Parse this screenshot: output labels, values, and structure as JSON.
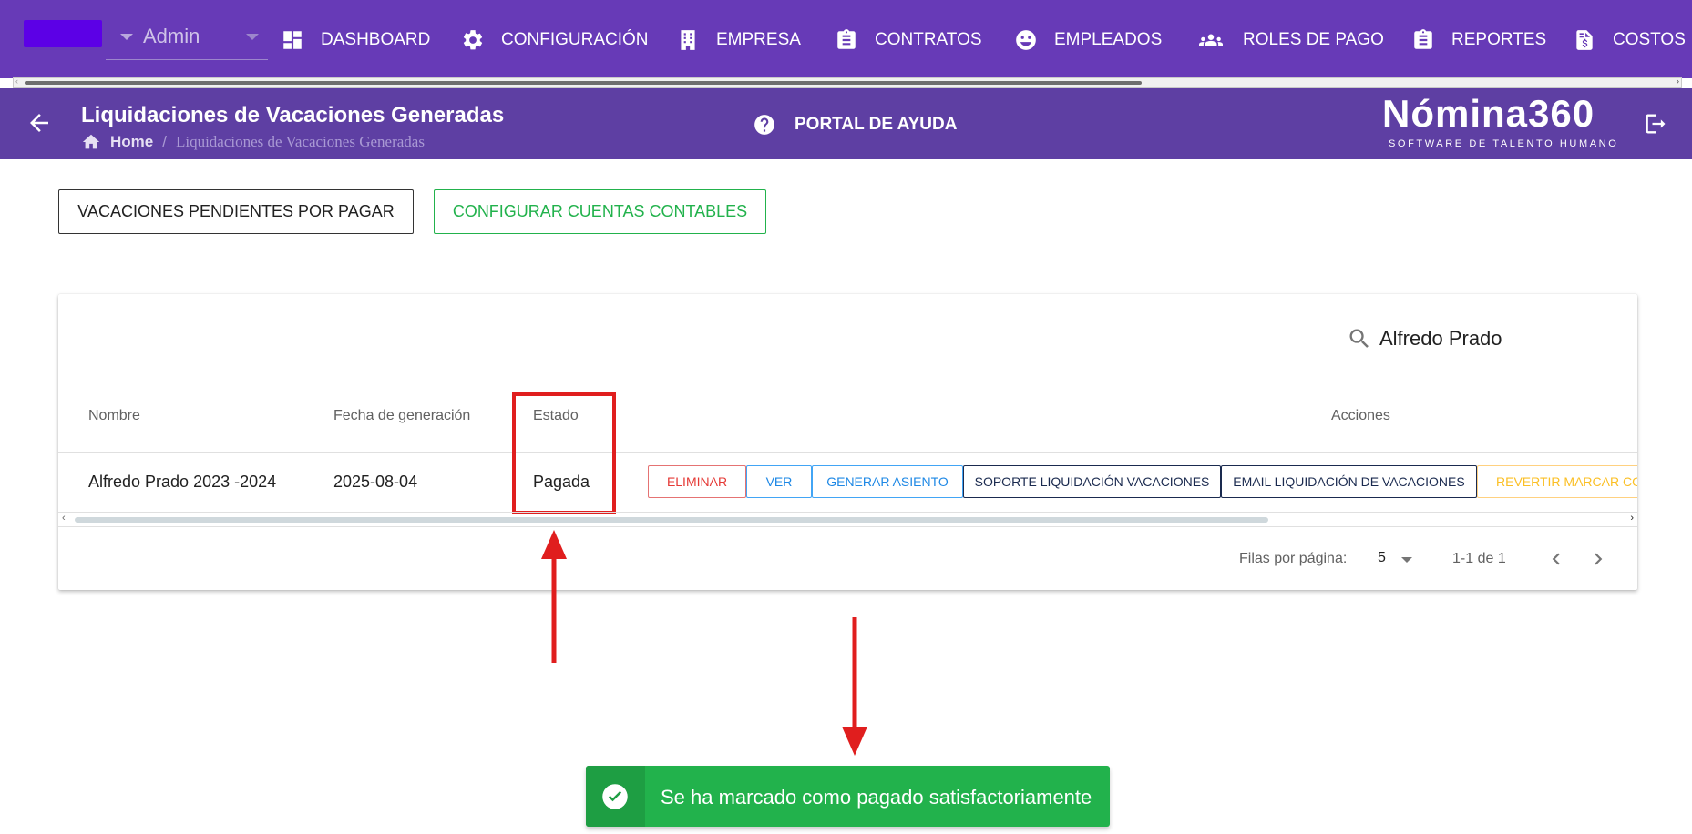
{
  "nav": {
    "role": "Admin",
    "items": [
      {
        "label": "DASHBOARD",
        "icon": "dashboard-icon"
      },
      {
        "label": "CONFIGURACIÓN",
        "icon": "gear-icon"
      },
      {
        "label": "EMPRESA",
        "icon": "building-icon"
      },
      {
        "label": "CONTRATOS",
        "icon": "clipboard-icon"
      },
      {
        "label": "EMPLEADOS",
        "icon": "face-icon"
      },
      {
        "label": "ROLES DE PAGO",
        "icon": "users-icon"
      },
      {
        "label": "REPORTES",
        "icon": "clipboard-list-icon"
      },
      {
        "label": "COSTOS",
        "icon": "invoice-dollar-icon"
      }
    ]
  },
  "header": {
    "title": "Liquidaciones de Vacaciones Generadas",
    "breadcrumb": {
      "home": "Home",
      "separator": "/",
      "current": "Liquidaciones de Vacaciones Generadas"
    },
    "help": "PORTAL DE AYUDA",
    "logo": "Nómina360",
    "logo_tagline": "SOFTWARE DE TALENTO HUMANO"
  },
  "actions": {
    "pending": "VACACIONES PENDIENTES POR PAGAR",
    "accounts": "CONFIGURAR CUENTAS CONTABLES"
  },
  "search": {
    "value": "Alfredo Prado"
  },
  "table": {
    "headers": {
      "name": "Nombre",
      "date": "Fecha de generación",
      "status": "Estado",
      "actions": "Acciones"
    },
    "rows": [
      {
        "name": "Alfredo Prado 2023 -2024",
        "date": "2025-08-04",
        "status": "Pagada",
        "buttons": {
          "delete": "ELIMINAR",
          "view": "VER",
          "entry": "GENERAR ASIENTO",
          "support": "SOPORTE LIQUIDACIÓN VACACIONES",
          "email": "EMAIL LIQUIDACIÓN DE VACACIONES",
          "revert": "REVERTIR MARCAR COM"
        }
      }
    ]
  },
  "pagination": {
    "rows_label": "Filas por página:",
    "rows_value": "5",
    "range": "1-1 de 1"
  },
  "toast": {
    "message": "Se ha marcado como pagado satisfactoriamente"
  },
  "colors": {
    "primary": "#673ab7",
    "subheader": "#5e3fa3",
    "success": "#22b24c",
    "annotation": "#e01e1e"
  }
}
